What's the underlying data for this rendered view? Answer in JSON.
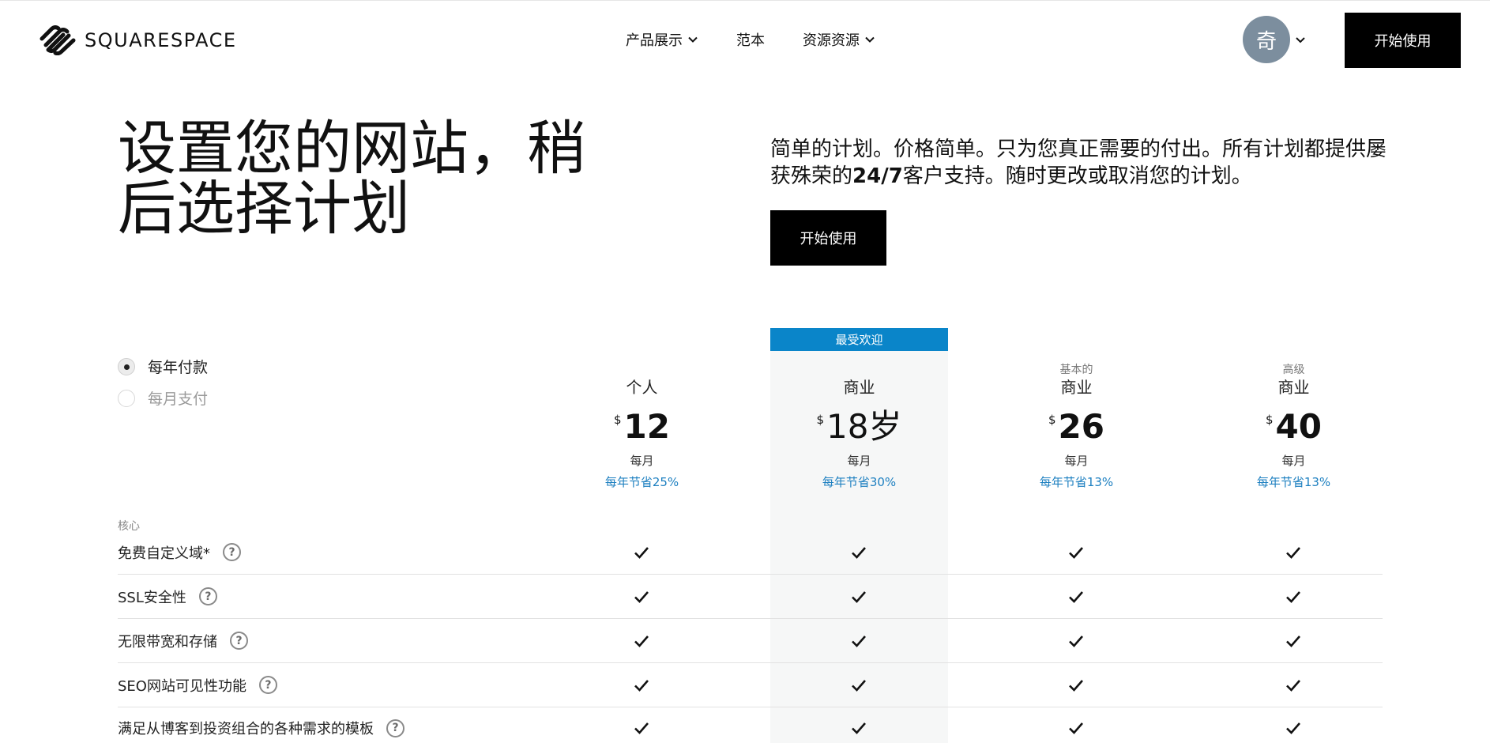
{
  "header": {
    "logo_text": "SQUARESPACE",
    "nav": [
      {
        "label": "产品展示",
        "has_dropdown": true
      },
      {
        "label": "范本",
        "has_dropdown": false
      },
      {
        "label": "资源资源",
        "has_dropdown": true
      }
    ],
    "avatar_initial": "奇",
    "avatar_color": "#7c8e9e",
    "cta_label": "开始使用"
  },
  "hero": {
    "title_line1": "设置您的网站，稍",
    "title_line2": "后选择计划",
    "desc_part1": "简单的计划。价格简单。只为您真正需要的付出。所有计划都提供屡获殊荣的",
    "desc_bold": "24/7",
    "desc_part2": "客户支持。随时更改或取消您的计划。",
    "cta_label": "开始使用"
  },
  "billing": {
    "annual_label": "每年付款",
    "monthly_label": "每月支付",
    "selected": "annual"
  },
  "popular_badge": "最受欢迎",
  "accent_color": "#0a85c9",
  "plans": [
    {
      "pre": "",
      "name": "个人",
      "currency": "$",
      "price": "12",
      "period": "每月",
      "save": "每年节省25%"
    },
    {
      "pre": "",
      "name": "商业",
      "currency": "$",
      "price": "18岁",
      "period": "每月",
      "save": "每年节省30%"
    },
    {
      "pre": "基本的",
      "name": "商业",
      "currency": "$",
      "price": "26",
      "period": "每月",
      "save": "每年节省13%"
    },
    {
      "pre": "高级",
      "name": "商业",
      "currency": "$",
      "price": "40",
      "period": "每月",
      "save": "每年节省13%"
    }
  ],
  "features": {
    "section_label": "核心",
    "rows": [
      {
        "label": "免费自定义域*",
        "help": "?",
        "included": [
          true,
          true,
          true,
          true
        ]
      },
      {
        "label": "SSL安全性",
        "help": "?",
        "included": [
          true,
          true,
          true,
          true
        ]
      },
      {
        "label": "无限带宽和存储",
        "help": "?",
        "included": [
          true,
          true,
          true,
          true
        ]
      },
      {
        "label": "SEO网站可见性功能",
        "help": "?",
        "included": [
          true,
          true,
          true,
          true
        ]
      },
      {
        "label": "满足从博客到投资组合的各种需求的模板",
        "help": "?",
        "included": [
          true,
          true,
          true,
          true
        ]
      }
    ]
  }
}
